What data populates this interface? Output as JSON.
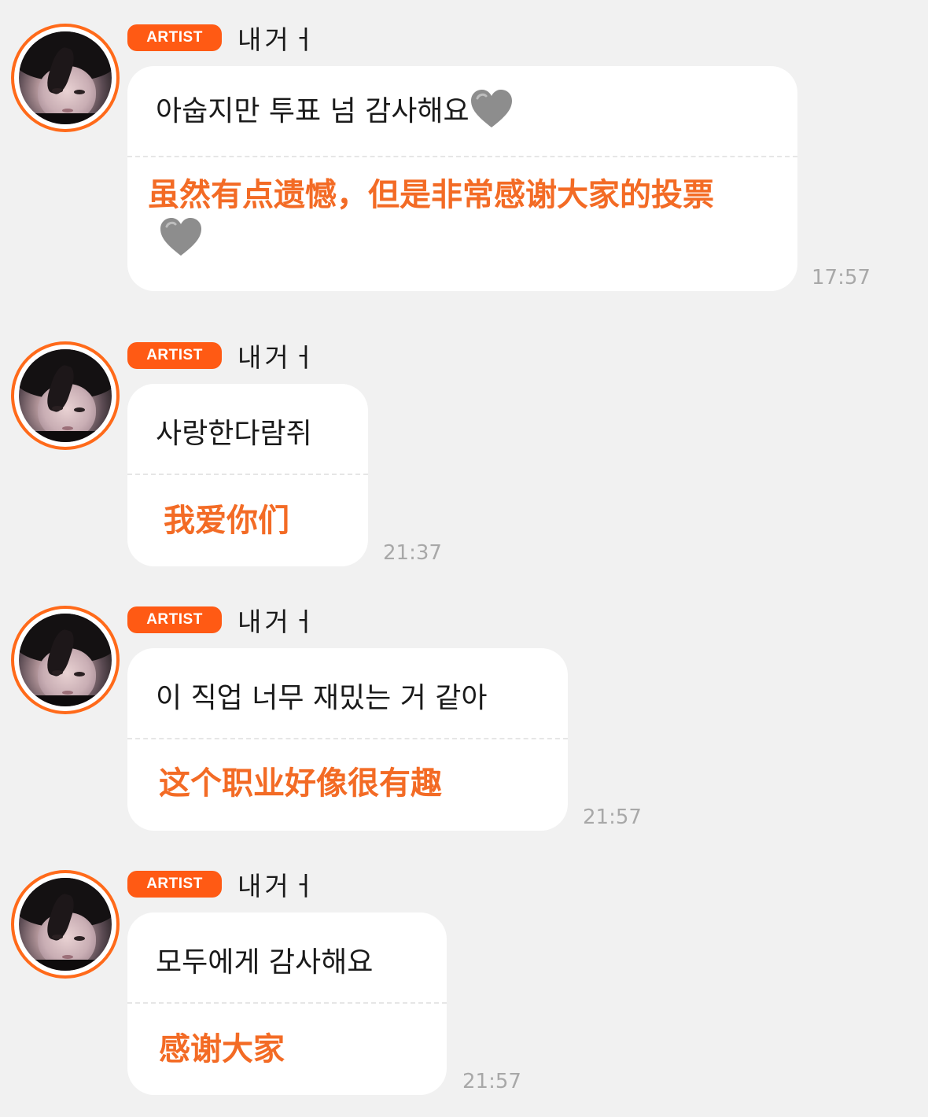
{
  "messages": [
    {
      "badge": "ARTIST",
      "username": "내거ㅓ",
      "text_ko": "아숩지만 투표 넘 감사해요",
      "text_zh": "虽然有点遗憾，但是非常感谢大家的投票",
      "emoji": "grey-heart",
      "time": "17:57"
    },
    {
      "badge": "ARTIST",
      "username": "내거ㅓ",
      "text_ko": "사랑한다람쥐",
      "text_zh": "我爱你们",
      "time": "21:37"
    },
    {
      "badge": "ARTIST",
      "username": "내거ㅓ",
      "text_ko": "이 직업 너무 재밌는 거 같아",
      "text_zh": "这个职业好像很有趣",
      "time": "21:57"
    },
    {
      "badge": "ARTIST",
      "username": "내거ㅓ",
      "text_ko": "모두에게 감사해요",
      "text_zh": "感谢大家",
      "time": "21:57"
    }
  ],
  "colors": {
    "background": "#f1f1f1",
    "accent": "#ff5a14",
    "translation_text": "#f36b25",
    "timestamp": "#a8a8a8",
    "bubble": "#ffffff"
  }
}
